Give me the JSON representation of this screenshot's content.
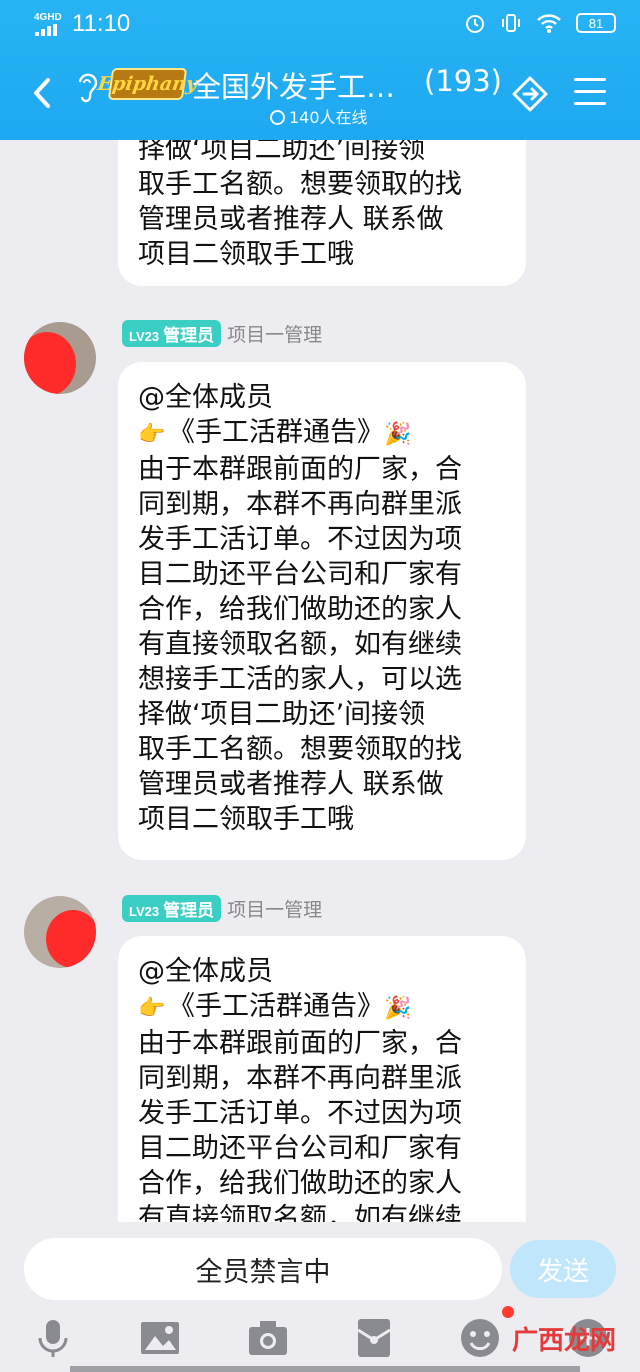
{
  "status_bar": {
    "network": "4GHD",
    "time": "11:10",
    "battery": "81"
  },
  "header": {
    "logo_text": "Epiphany",
    "title": "全国外发手工…",
    "member_count": "(193)",
    "online": "140人在线"
  },
  "message_top": {
    "lines": [
      "择做‘项目二助还’间接领",
      "取手工名额。想要领取的找",
      "管理员或者推荐人 联系做",
      "项目二领取手工哦"
    ]
  },
  "message_1": {
    "badge_level": "LV23",
    "badge_role": "管理员",
    "sender": "项目一管理",
    "mention": "@全体成员",
    "notice_title": "《手工活群通告》",
    "lines": [
      "由于本群跟前面的厂家，合",
      "同到期，本群不再向群里派",
      "发手工活订单。不过因为项",
      "目二助还平台公司和厂家有",
      "合作，给我们做助还的家人",
      "有直接领取名额，如有继续",
      "想接手工活的家人，可以选",
      "择做‘项目二助还’间接领",
      "取手工名额。想要领取的找",
      "管理员或者推荐人 联系做",
      "项目二领取手工哦"
    ]
  },
  "message_2": {
    "badge_level": "LV23",
    "badge_role": "管理员",
    "sender": "项目一管理",
    "mention": "@全体成员",
    "notice_title": "《手工活群通告》",
    "lines": [
      "由于本群跟前面的厂家，合",
      "同到期，本群不再向群里派",
      "发手工活订单。不过因为项",
      "目二助还平台公司和厂家有",
      "合作，给我们做助还的家人",
      "有直接领取名额，如有继续"
    ]
  },
  "input": {
    "muted_text": "全员禁言中",
    "send_label": "发送"
  },
  "toolbar": [
    "microphone-icon",
    "image-icon",
    "camera-icon",
    "red-packet-icon",
    "emoji-icon",
    "plus-icon"
  ],
  "watermark": "广西龙网",
  "colors": {
    "header": "#1ea8f1",
    "badge": "#3bcfc4",
    "send_disabled": "#bfe6fb"
  }
}
